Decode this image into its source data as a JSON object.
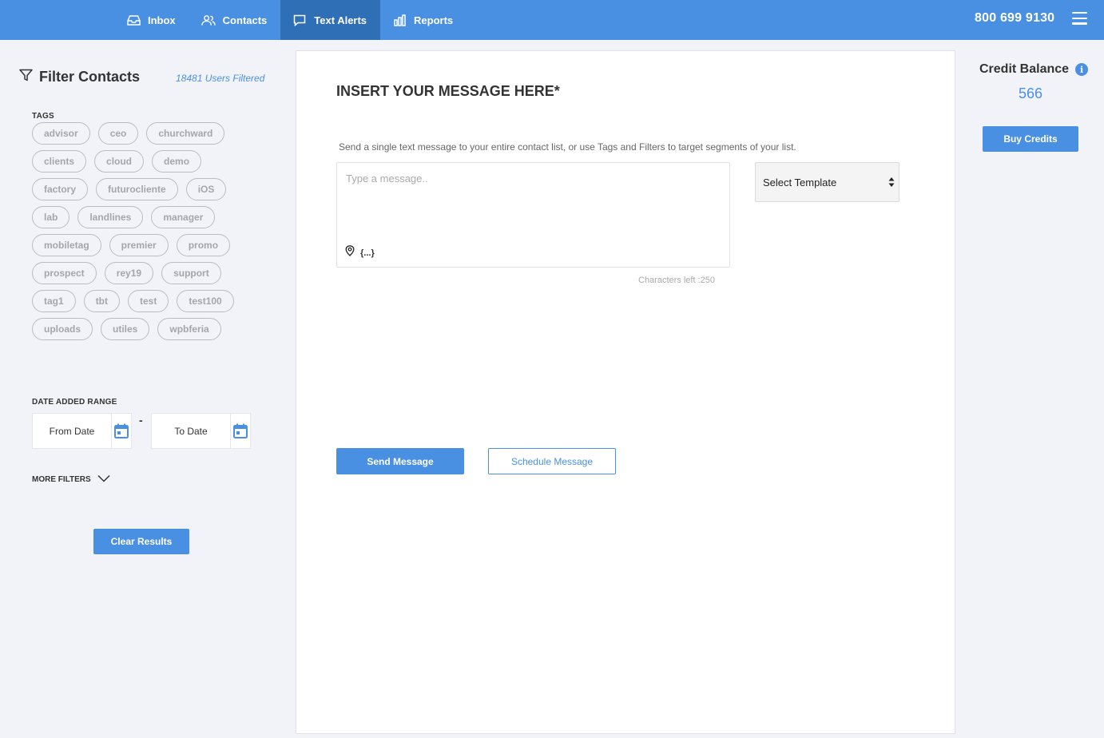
{
  "topbar": {
    "nav": [
      {
        "label": "Inbox",
        "icon": "inbox-icon",
        "active": false
      },
      {
        "label": "Contacts",
        "icon": "contacts-icon",
        "active": false
      },
      {
        "label": "Text Alerts",
        "icon": "chat-bubble-icon",
        "active": true
      },
      {
        "label": "Reports",
        "icon": "bar-chart-icon",
        "active": false
      }
    ],
    "phone": "800 699 9130",
    "menu_icon": "hamburger-menu-icon"
  },
  "sidebar": {
    "title": "Filter Contacts",
    "filtered_count": "18481 Users Filtered",
    "tags_label": "TAGS",
    "tags": [
      "advisor",
      "ceo",
      "churchward",
      "clients",
      "cloud",
      "demo",
      "factory",
      "futurocliente",
      "iOS",
      "lab",
      "landlines",
      "manager",
      "mobiletag",
      "premier",
      "promo",
      "prospect",
      "rey19",
      "support",
      "tag1",
      "tbt",
      "test",
      "test100",
      "uploads",
      "utiles",
      "wpbferia"
    ],
    "date_range_label": "DATE ADDED RANGE",
    "from_date": "From Date",
    "date_separator": "-",
    "to_date": "To Date",
    "more_filters": "MORE FILTERS",
    "clear_button": "Clear Results"
  },
  "main": {
    "title": "INSERT YOUR MESSAGE HERE*",
    "description": "Send a single text message to your entire contact list, or use Tags and Filters to target segments of your list.",
    "message_placeholder": "Type a message..",
    "message_value": "",
    "variable_button": "{...}",
    "chars_left": "Characters left :250",
    "template_select": "Select Template",
    "send_button": "Send Message",
    "schedule_button": "Schedule Message"
  },
  "credits": {
    "title": "Credit Balance",
    "value": "566",
    "buy_button": "Buy Credits"
  },
  "colors": {
    "accent": "#4a90e2",
    "nav_active": "#2f6fb6",
    "background": "#f2f3f8"
  }
}
